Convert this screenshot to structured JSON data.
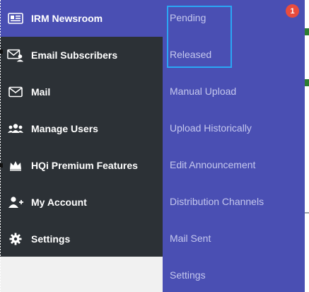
{
  "sidebar": {
    "items": [
      {
        "label": "IRM Newsroom",
        "icon": "newspaper-icon"
      },
      {
        "label": "Email Subscribers",
        "icon": "email-subscribers-icon"
      },
      {
        "label": "Mail",
        "icon": "mail-icon"
      },
      {
        "label": "Manage Users",
        "icon": "users-icon"
      },
      {
        "label": "HQi Premium Features",
        "icon": "crown-icon"
      },
      {
        "label": "My Account",
        "icon": "user-add-icon"
      },
      {
        "label": "Settings",
        "icon": "gear-icon"
      }
    ]
  },
  "submenu": {
    "items": [
      {
        "label": "Pending"
      },
      {
        "label": "Released"
      },
      {
        "label": "Manual Upload"
      },
      {
        "label": "Upload Historically"
      },
      {
        "label": "Edit Announcement"
      },
      {
        "label": "Distribution Channels"
      },
      {
        "label": "Mail Sent"
      },
      {
        "label": "Settings"
      }
    ]
  },
  "notifications": {
    "count": "1"
  },
  "colors": {
    "sidebar_bg": "#2c3136",
    "accent": "#4a4fb3",
    "submenu_text": "#c5c8ee",
    "highlight": "#2aa7f5",
    "badge": "#e84c3d"
  }
}
